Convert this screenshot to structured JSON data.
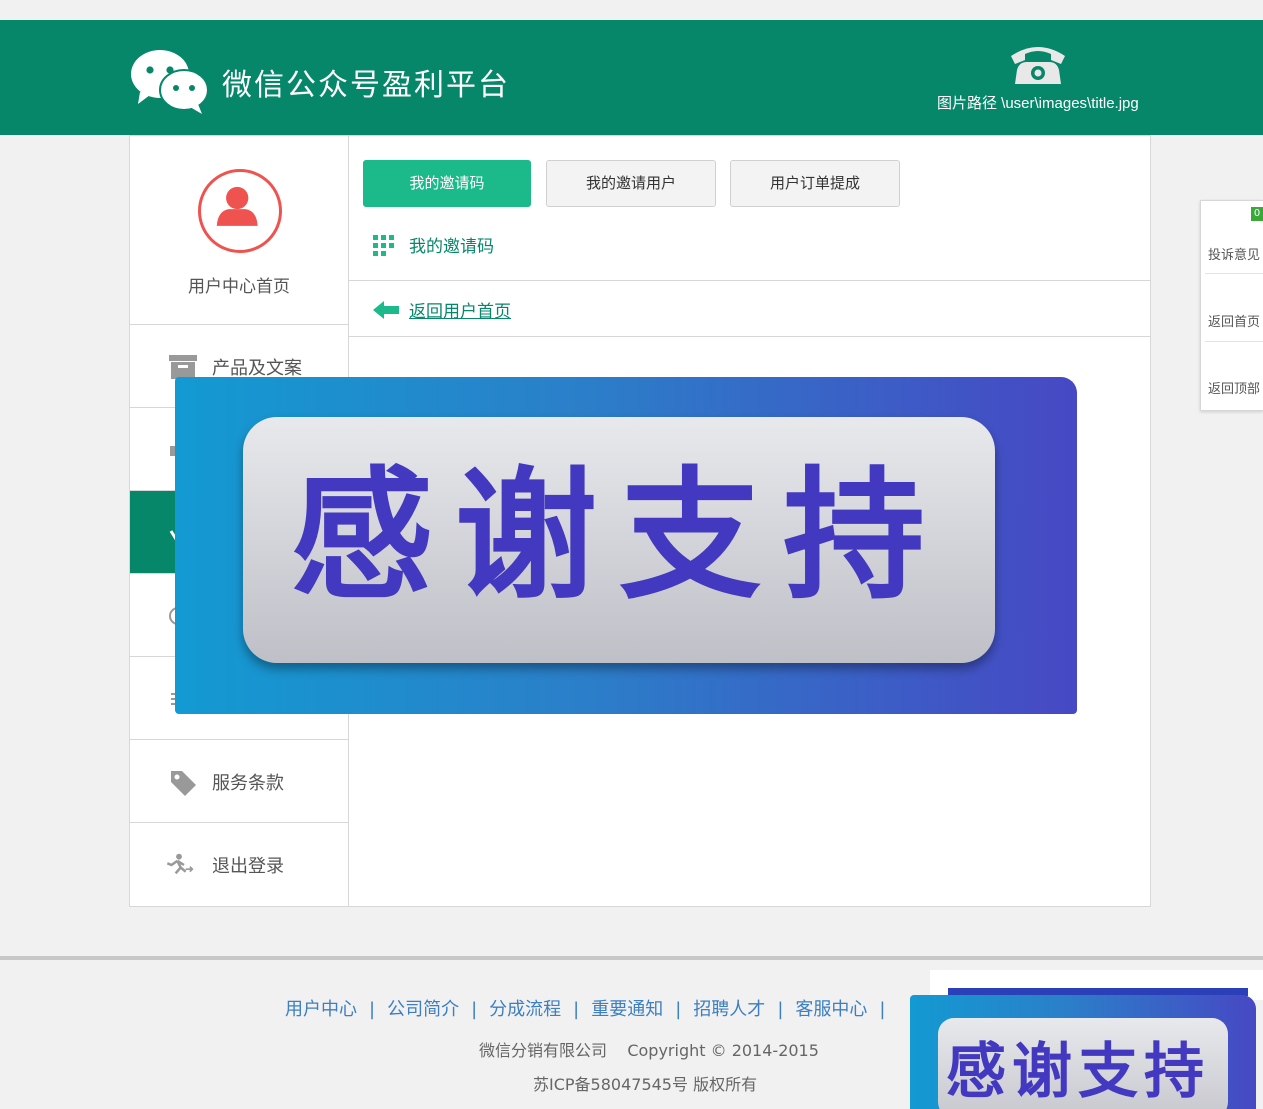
{
  "header": {
    "title": "微信公众号盈利平台",
    "image_path": "图片路径 \\user\\images\\title.jpg"
  },
  "sidebar": {
    "user_center": "用户中心首页",
    "items": [
      {
        "label": "产品及文案",
        "icon": "archive-icon"
      },
      {
        "label": "",
        "icon": "hidden-icon"
      },
      {
        "label": "",
        "icon": "hidden-icon"
      },
      {
        "label": "",
        "icon": "comment-icon"
      },
      {
        "label": "",
        "icon": "list-icon"
      },
      {
        "label": "服务条款",
        "icon": "tag-icon"
      },
      {
        "label": "退出登录",
        "icon": "logout-icon"
      }
    ]
  },
  "tabs": [
    {
      "label": "我的邀请码"
    },
    {
      "label": "我的邀请用户"
    },
    {
      "label": "用户订单提成"
    }
  ],
  "content": {
    "section_title": "我的邀请码",
    "back_link": "返回用户首页"
  },
  "banner": {
    "text": "感谢支持"
  },
  "float_panel": {
    "badge": "0",
    "items": [
      "投诉意见",
      "返回首页",
      "返回顶部"
    ]
  },
  "footer": {
    "links": [
      "用户中心",
      "公司简介",
      "分成流程",
      "重要通知",
      "招聘人才",
      "客服中心"
    ],
    "copyright": "微信分销有限公司    Copyright © 2014-2015",
    "icp": "苏ICP备58047545号 版权所有"
  },
  "colors": {
    "brand_green": "#07876a",
    "tab_active": "#1cb98a",
    "link_blue": "#3d7fc1",
    "banner_text": "#4338c0"
  }
}
